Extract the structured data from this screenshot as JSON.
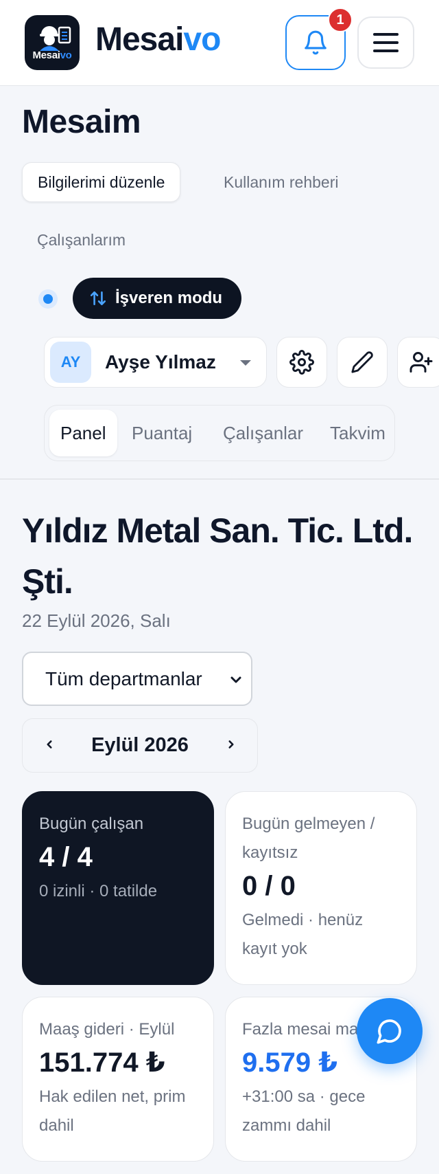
{
  "header": {
    "logo_text_main": "Mesai",
    "logo_text_accent": "vo",
    "brand_main": "Mesai",
    "brand_accent": "vo",
    "notification_count": "1",
    "icons": {
      "bell": "bell-icon",
      "menu": "hamburger-menu-icon"
    }
  },
  "mesaim": {
    "title": "Mesaim",
    "tabs": [
      {
        "label": "Bilgilerimi düzenle",
        "active": true
      },
      {
        "label": "Kullanım rehberi",
        "active": false
      },
      {
        "label": "Çalışanlarım",
        "active": false
      }
    ],
    "mode_button": "İşveren modu",
    "user": {
      "initials": "AY",
      "name": "Ayşe Yılmaz"
    },
    "icon_buttons": [
      "gear-icon",
      "pencil-icon",
      "user-plus-icon"
    ],
    "segments": [
      {
        "label": "Panel",
        "active": true
      },
      {
        "label": "Puantaj",
        "active": false
      },
      {
        "label": "Çalışanlar",
        "active": false
      },
      {
        "label": "Takvim",
        "active": false
      }
    ]
  },
  "company": {
    "name": "Yıldız Metal San. Tic. Ltd. Şti.",
    "date": "22 Eylül 2026, Salı",
    "department_selected": "Tüm departmanlar",
    "month": "Eylül 2026"
  },
  "stats": [
    {
      "label": "Bugün çalışan",
      "value": "4 / 4",
      "sub": "0 izinli · 0 tatilde",
      "style": "dark"
    },
    {
      "label": "Bugün gelmeyen / kayıtsız",
      "value": "0 / 0",
      "sub": "Gelmedi · henüz kayıt yok",
      "style": "light"
    },
    {
      "label": "Maaş gideri · Eylül",
      "value": "151.774 ₺",
      "sub": "Hak edilen net, prim dahil",
      "style": "light"
    },
    {
      "label": "Fazla mesai ma",
      "value": "9.579 ₺",
      "sub": "+31:00 sa · gece zammı dahil",
      "style": "light-blue"
    }
  ],
  "colors": {
    "accent": "#1e88f5",
    "dark": "#0f1624",
    "badge": "#dc2f2f",
    "background": "#f4f6fa"
  }
}
